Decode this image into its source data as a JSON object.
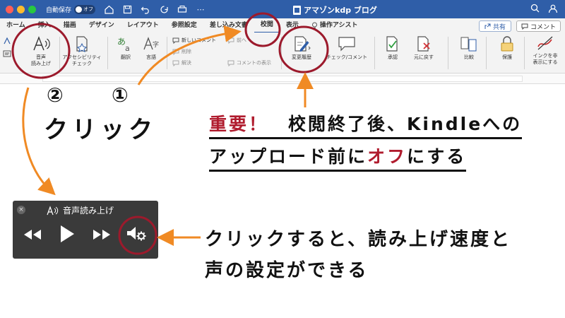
{
  "titlebar": {
    "autosave_label": "自動保存",
    "autosave_state": "オフ",
    "doc_title": "アマゾンkdp ブログ",
    "search_icon": "search-icon",
    "account_icon": "account-icon"
  },
  "tabs": [
    {
      "label": "ホーム"
    },
    {
      "label": "挿入"
    },
    {
      "label": "描画"
    },
    {
      "label": "デザイン"
    },
    {
      "label": "レイアウト"
    },
    {
      "label": "参照設定"
    },
    {
      "label": "差し込み文書"
    },
    {
      "label": "校閲"
    },
    {
      "label": "表示"
    },
    {
      "label": "操作アシスト"
    }
  ],
  "share_label": "共有",
  "comment_label": "コメント",
  "ribbon": {
    "read_aloud_line1": "音声",
    "read_aloud_line2": "読み上げ",
    "accessibility_line1": "アクセシビリティ",
    "accessibility_line2": "チェック",
    "translate": "翻訳",
    "language": "言語",
    "new_comment": "新しいコメント",
    "delete": "削除",
    "resolve": "解決",
    "prev": "前へ",
    "show_comments": "コメントの表示",
    "track_changes": "変更履歴",
    "check_comments": "チェック/コメント",
    "accept": "承認",
    "reject": "元に戻す",
    "compare": "比較",
    "protect": "保護",
    "ink_line1": "インクを非",
    "ink_line2": "表示にする"
  },
  "colors": {
    "titlebar": "#2f5ea8",
    "annotation_red": "#9c1a2c",
    "arrow_orange": "#f08a24",
    "emphasis_red": "#b01c2e"
  },
  "annotations": {
    "step2": "②",
    "step1": "①",
    "click": "クリック",
    "important": "重要！",
    "note_line1_rest": "　校閲終了後、Kindleへの",
    "note_line2_start": "アップロード前に",
    "note_line2_red": "オフ",
    "note_line2_end": "にする",
    "desc_line1": "クリックすると、読み上げ速度と",
    "desc_line2": "声の設定ができる"
  },
  "read_aloud_panel": {
    "title": "音声読み上げ",
    "close_symbol": "×"
  }
}
